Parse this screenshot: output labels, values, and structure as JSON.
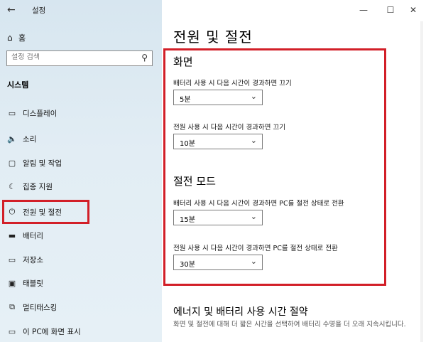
{
  "window": {
    "title": "설정",
    "back": "←",
    "minimize": "—",
    "maximize": "☐",
    "close": "✕"
  },
  "sidebar": {
    "home_label": "홈",
    "search_placeholder": "설정 검색",
    "section_title": "시스템",
    "items": [
      {
        "label": "디스플레이",
        "icon": "display-icon"
      },
      {
        "label": "소리",
        "icon": "speaker-icon"
      },
      {
        "label": "알림 및 작업",
        "icon": "notification-icon"
      },
      {
        "label": "집중 지원",
        "icon": "moon-icon"
      },
      {
        "label": "전원 및 절전",
        "icon": "power-icon",
        "selected": true
      },
      {
        "label": "배터리",
        "icon": "battery-icon"
      },
      {
        "label": "저장소",
        "icon": "storage-icon"
      },
      {
        "label": "태블릿",
        "icon": "tablet-icon"
      },
      {
        "label": "멀티태스킹",
        "icon": "multitasking-icon"
      },
      {
        "label": "이 PC에 화면 표시",
        "icon": "project-icon"
      }
    ]
  },
  "main": {
    "title": "전원 및 절전",
    "screen": {
      "heading": "화면",
      "battery_label": "배터리 사용 시 다음 시간이 경과하면 끄기",
      "battery_value": "5분",
      "power_label": "전원 사용 시 다음 시간이 경과하면 끄기",
      "power_value": "10분"
    },
    "sleep": {
      "heading": "절전 모드",
      "battery_label": "배터리 사용 시 다음 시간이 경과하면 PC를 절전 상태로 전환",
      "battery_value": "15분",
      "power_label": "전원 사용 시 다음 시간이 경과하면 PC를 절전 상태로 전환",
      "power_value": "30분"
    },
    "energy": {
      "heading": "에너지 및 배터리 사용 시간 절약",
      "description": "화면 및 절전에 대해 더 짧은 시간을 선택하여 배터리 수명을 더 오래 지속시킵니다."
    }
  },
  "colors": {
    "highlight": "#d21f28",
    "sidebar_bg": "#dde9f2"
  }
}
